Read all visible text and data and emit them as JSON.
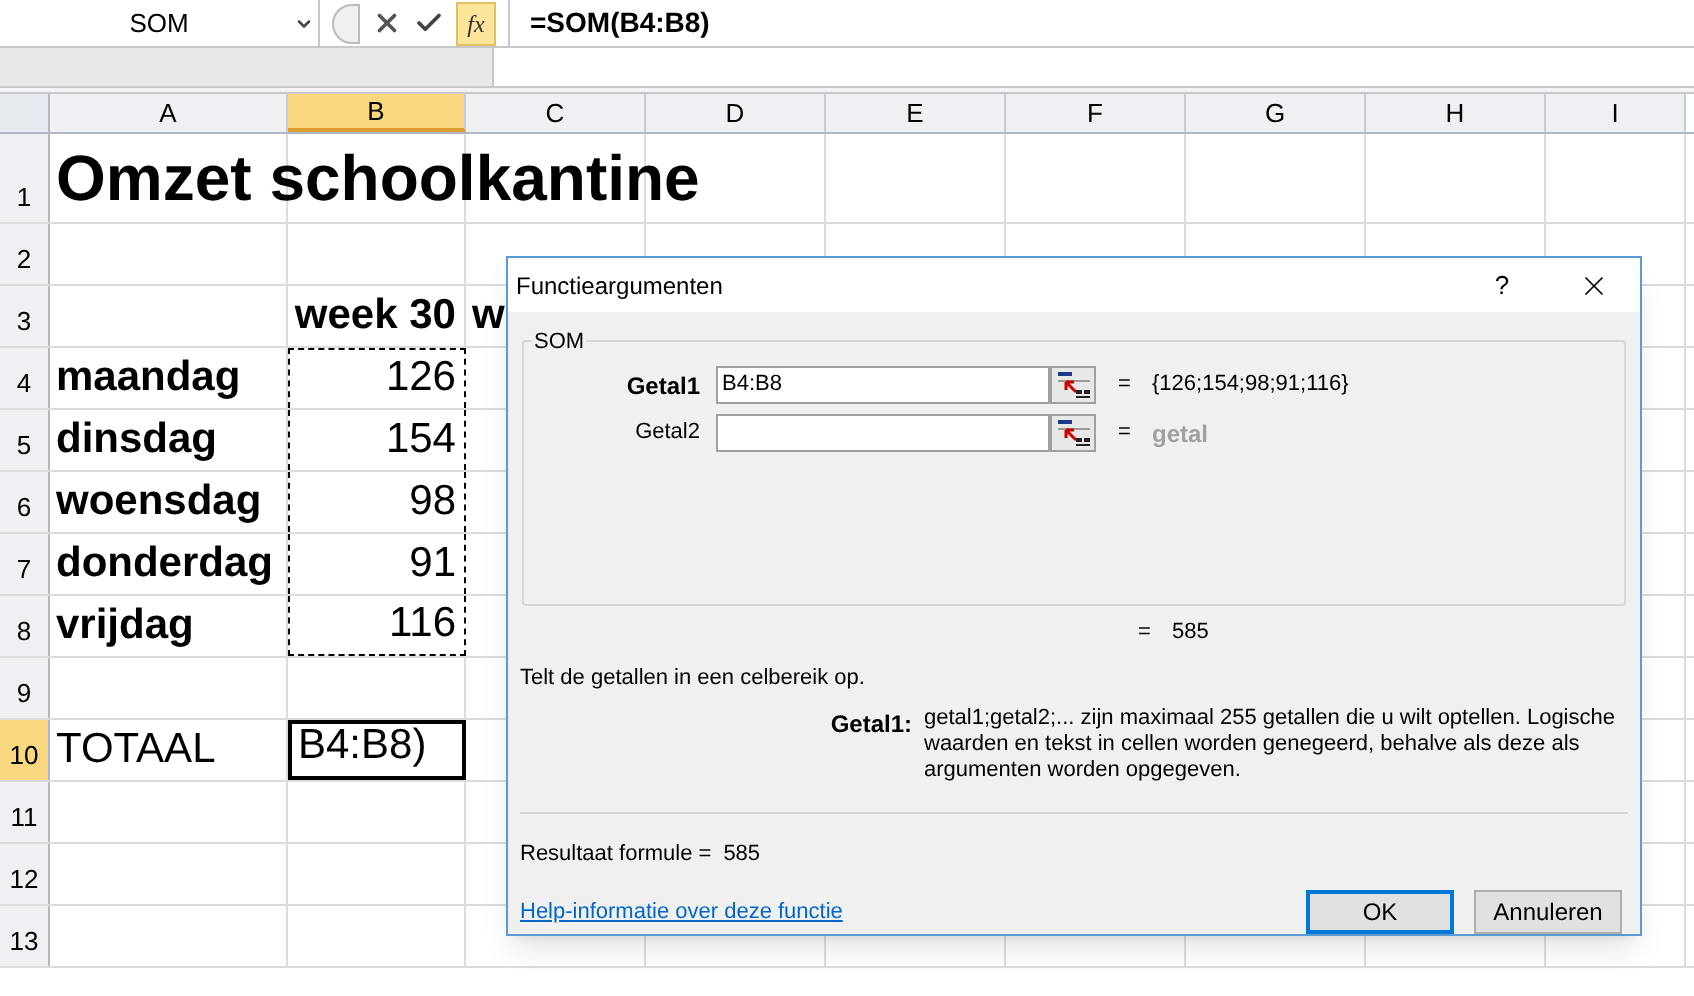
{
  "formula_bar": {
    "name_box": "SOM",
    "function_button": "fx",
    "formula": "=SOM(B4:B8)"
  },
  "sheet": {
    "columns": [
      {
        "label": "A",
        "selected": false
      },
      {
        "label": "B",
        "selected": true
      },
      {
        "label": "C",
        "selected": false
      },
      {
        "label": "D",
        "selected": false
      },
      {
        "label": "E",
        "selected": false
      },
      {
        "label": "F",
        "selected": false
      },
      {
        "label": "G",
        "selected": false
      },
      {
        "label": "H",
        "selected": false
      },
      {
        "label": "I",
        "selected": false
      }
    ],
    "rows": [
      {
        "label": "1",
        "selected": false,
        "kind": "title",
        "cells": {
          "A": {
            "text": "Omzet schoolkantine",
            "bold": true,
            "right_aligned": false
          }
        }
      },
      {
        "label": "2",
        "selected": false,
        "kind": "normal",
        "cells": {}
      },
      {
        "label": "3",
        "selected": false,
        "kind": "normal",
        "cells": {
          "B": {
            "text": "week 30",
            "bold": true,
            "right_aligned": true
          },
          "C": {
            "text": "w",
            "bold": true,
            "right_aligned": false
          }
        }
      },
      {
        "label": "4",
        "selected": false,
        "kind": "normal",
        "cells": {
          "A": {
            "text": "maandag",
            "bold": true,
            "right_aligned": false
          },
          "B": {
            "text": "126",
            "bold": false,
            "right_aligned": true,
            "marquee": true
          }
        }
      },
      {
        "label": "5",
        "selected": false,
        "kind": "normal",
        "cells": {
          "A": {
            "text": "dinsdag",
            "bold": true,
            "right_aligned": false
          },
          "B": {
            "text": "154",
            "bold": false,
            "right_aligned": true,
            "marquee": true
          }
        }
      },
      {
        "label": "6",
        "selected": false,
        "kind": "normal",
        "cells": {
          "A": {
            "text": "woensdag",
            "bold": true,
            "right_aligned": false
          },
          "B": {
            "text": "98",
            "bold": false,
            "right_aligned": true,
            "marquee": true
          }
        }
      },
      {
        "label": "7",
        "selected": false,
        "kind": "normal",
        "cells": {
          "A": {
            "text": "donderdag",
            "bold": true,
            "right_aligned": false
          },
          "B": {
            "text": "91",
            "bold": false,
            "right_aligned": true,
            "marquee": true
          }
        }
      },
      {
        "label": "8",
        "selected": false,
        "kind": "normal",
        "cells": {
          "A": {
            "text": "vrijdag",
            "bold": true,
            "right_aligned": false
          },
          "B": {
            "text": "116",
            "bold": false,
            "right_aligned": true,
            "marquee": true
          }
        }
      },
      {
        "label": "9",
        "selected": false,
        "kind": "normal",
        "cells": {}
      },
      {
        "label": "10",
        "selected": true,
        "kind": "normal",
        "cells": {
          "A": {
            "text": "TOTAAL",
            "bold": false,
            "right_aligned": false
          },
          "B": {
            "text": "B4:B8)",
            "bold": false,
            "right_aligned": false,
            "active": true
          }
        }
      },
      {
        "label": "11",
        "selected": false,
        "kind": "normal",
        "cells": {}
      },
      {
        "label": "12",
        "selected": false,
        "kind": "normal",
        "cells": {}
      },
      {
        "label": "13",
        "selected": false,
        "kind": "normal",
        "cells": {}
      }
    ]
  },
  "dialog": {
    "title": "Functieargumenten",
    "help": "?",
    "group": "SOM",
    "arguments": [
      {
        "label": "Getal1",
        "bold": true,
        "value": "B4:B8",
        "result": "{126;154;98;91;116}",
        "muted": false
      },
      {
        "label": "Getal2",
        "bold": false,
        "result": "getal",
        "muted": true
      }
    ],
    "equals": "=",
    "result": "585",
    "description": "Telt de getallen in een celbereik op.",
    "arg_help": {
      "label": "Getal1:",
      "text": "getal1;getal2;... zijn maximaal 255 getallen die u wilt optellen. Logische waarden en tekst in cellen worden genegeerd, behalve als deze als argumenten worden opgegeven."
    },
    "formula_result_label": "Resultaat formule =",
    "formula_result": "585",
    "link": "Help-informatie over deze functie",
    "buttons": [
      {
        "label": "OK",
        "default": true
      },
      {
        "label": "Annuleren",
        "default": false
      }
    ]
  }
}
